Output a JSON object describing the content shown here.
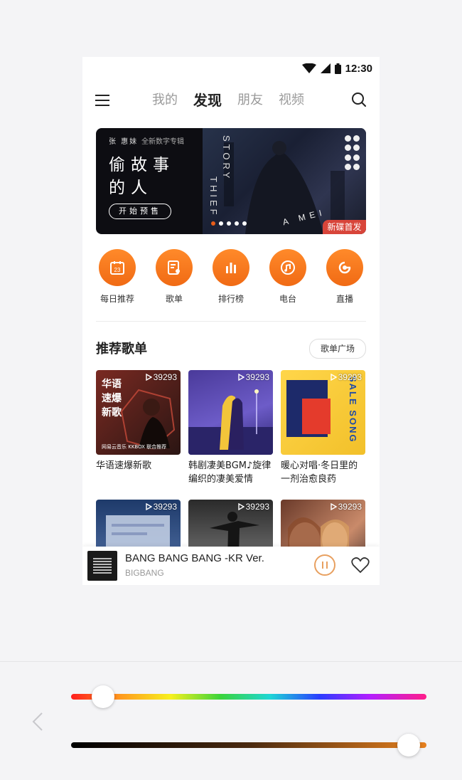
{
  "status_bar": {
    "time": "12:30"
  },
  "header": {
    "tabs": [
      "我的",
      "发现",
      "朋友",
      "视频"
    ],
    "active_tab_index": 1
  },
  "banner": {
    "artist": "张 惠妹",
    "subtitle": "全新数字专辑",
    "title_line1": "偷故事",
    "title_line2": "的人",
    "button": "开始预售",
    "vertical_text_1": "STORY",
    "vertical_text_2": "THIEF",
    "signature": "A MEI",
    "badge": "新碟首发",
    "slide_count": 5,
    "active_slide": 0
  },
  "quick_actions": [
    {
      "label": "每日推荐",
      "icon": "calendar-icon",
      "icon_text": "23"
    },
    {
      "label": "歌单",
      "icon": "playlist-icon"
    },
    {
      "label": "排行榜",
      "icon": "chart-icon"
    },
    {
      "label": "电台",
      "icon": "radio-icon"
    },
    {
      "label": "直播",
      "icon": "live-icon"
    }
  ],
  "recommend": {
    "title": "推荐歌单",
    "more_button": "歌单广场",
    "playlists": [
      {
        "title": "华语速爆新歌",
        "plays": "39293",
        "cover_text": "华语\n速爆\n新歌",
        "cover_logo": "网易云音乐 KKBOX 联合推荐"
      },
      {
        "title": "韩剧凄美BGM♪旋律编织的凄美爱情",
        "plays": "39293"
      },
      {
        "title": "暖心对唱·冬日里的一剂治愈良药",
        "plays": "39293",
        "cover_text": "SALE SONG"
      },
      {
        "title": "",
        "plays": "39293"
      },
      {
        "title": "",
        "plays": "39293"
      },
      {
        "title": "",
        "plays": "39293"
      }
    ]
  },
  "player": {
    "song": "BANG BANG BANG -KR Ver.",
    "artist": "BIGBANG",
    "state": "playing"
  },
  "color_controls": {
    "hue_value": 0.09,
    "tone_value": 0.95
  },
  "colors": {
    "accent": "#f07a1e",
    "badge": "#d8453a"
  }
}
